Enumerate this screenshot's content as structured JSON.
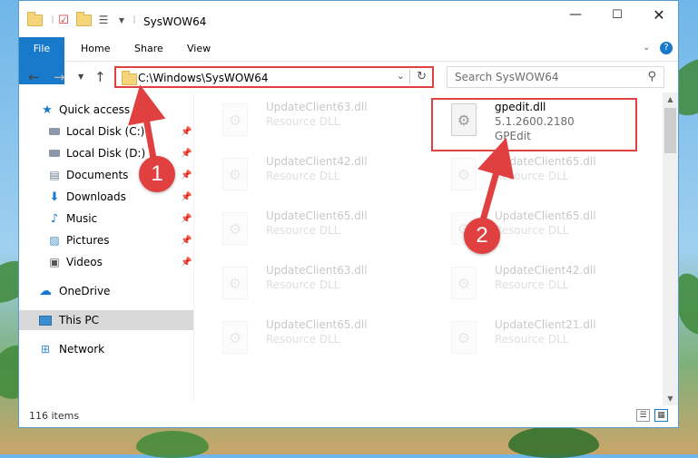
{
  "window": {
    "title": "SysWOW64"
  },
  "ribbon": {
    "tabs": [
      "File",
      "Home",
      "Share",
      "View"
    ]
  },
  "nav": {
    "address": "C:\\Windows\\SysWOW64",
    "search_placeholder": "Search SysWOW64"
  },
  "sidebar": {
    "items": [
      {
        "label": "Quick access",
        "icon": "star-icon"
      },
      {
        "label": "Local Disk (C:)",
        "icon": "drive-icon",
        "pinned": true
      },
      {
        "label": "Local Disk (D:)",
        "icon": "drive-icon",
        "pinned": true
      },
      {
        "label": "Documents",
        "icon": "documents-icon",
        "pinned": true
      },
      {
        "label": "Downloads",
        "icon": "download-icon",
        "pinned": true
      },
      {
        "label": "Music",
        "icon": "music-icon",
        "pinned": true
      },
      {
        "label": "Pictures",
        "icon": "pictures-icon",
        "pinned": true
      },
      {
        "label": "Videos",
        "icon": "videos-icon",
        "pinned": true
      },
      {
        "label": "OneDrive",
        "icon": "cloud-icon"
      },
      {
        "label": "This PC",
        "icon": "computer-icon",
        "selected": true
      },
      {
        "label": "Network",
        "icon": "network-icon"
      }
    ]
  },
  "files": {
    "left": [
      {
        "name": "UpdateClient63.dll",
        "type": "Resource DLL"
      },
      {
        "name": "UpdateClient42.dll",
        "type": "Resource DLL"
      },
      {
        "name": "UpdateClient65.dll",
        "type": "Resource DLL"
      },
      {
        "name": "UpdateClient63.dll",
        "type": "Resource DLL"
      },
      {
        "name": "UpdateClient65.dll",
        "type": "Resource DLL"
      }
    ],
    "right": [
      {
        "name": "gpedit.dll",
        "version": "5.1.2600.2180",
        "description": "GPEdit",
        "highlighted": true
      },
      {
        "name": "UpdateClient65.dll",
        "type": "Resource DLL"
      },
      {
        "name": "UpdateClient65.dll",
        "type": "Resource DLL"
      },
      {
        "name": "UpdateClient42.dll",
        "type": "Resource DLL"
      },
      {
        "name": "UpdateClient21.dll",
        "type": "Resource DLL"
      }
    ]
  },
  "status": {
    "item_count": "116 items"
  },
  "callouts": [
    "1",
    "2"
  ],
  "colors": {
    "accent": "#1979ca",
    "highlight": "#e04040"
  }
}
